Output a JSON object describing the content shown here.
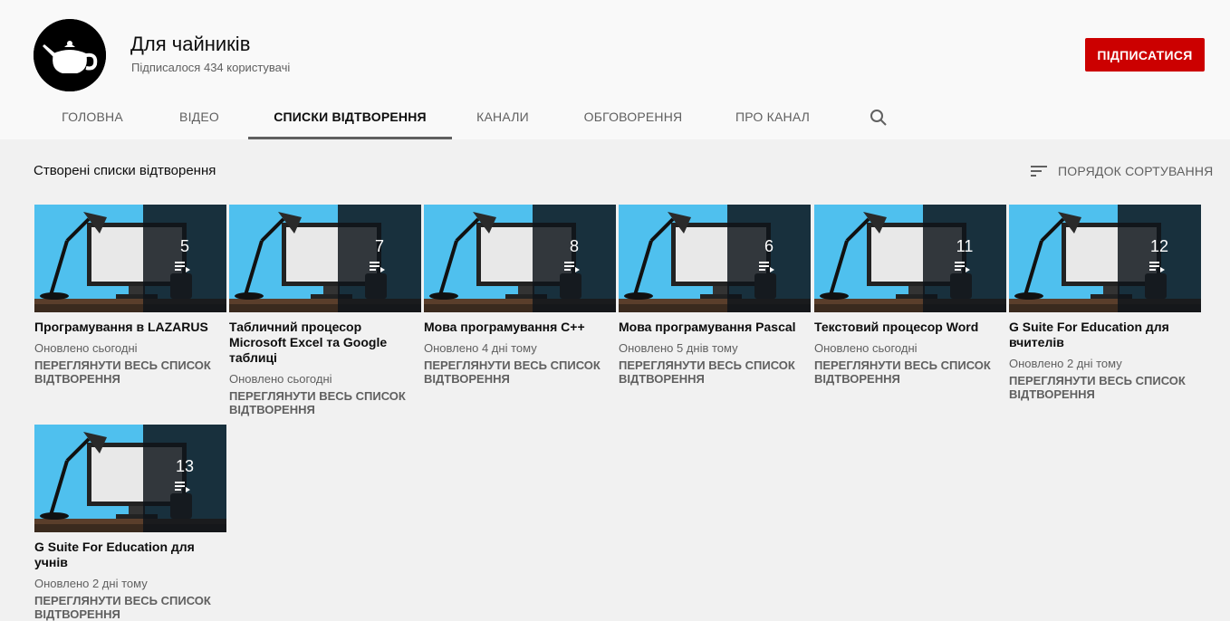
{
  "channel": {
    "name": "Для чайників",
    "subscribers": "Підписалося 434 користувачі",
    "subscribe_label": "ПІДПИСАТИСЯ"
  },
  "tabs": [
    {
      "label": "ГОЛОВНА",
      "active": false
    },
    {
      "label": "ВІДЕО",
      "active": false
    },
    {
      "label": "СПИСКИ ВІДТВОРЕННЯ",
      "active": true
    },
    {
      "label": "КАНАЛИ",
      "active": false
    },
    {
      "label": "ОБГОВОРЕННЯ",
      "active": false
    },
    {
      "label": "ПРО КАНАЛ",
      "active": false
    }
  ],
  "section": {
    "title": "Створені списки відтворення",
    "sort_label": "ПОРЯДОК СОРТУВАННЯ"
  },
  "view_all_label": "ПЕРЕГЛЯНУТИ ВЕСЬ СПИСОК ВІДТВОРЕННЯ",
  "playlists": [
    {
      "title": "Програмування в LAZARUS",
      "updated": "Оновлено сьогодні",
      "count": "5"
    },
    {
      "title": "Табличний процесор Microsoft Excel та Google таблиці",
      "updated": "Оновлено сьогодні",
      "count": "7"
    },
    {
      "title": "Мова програмування C++",
      "updated": "Оновлено 4 дні тому",
      "count": "8"
    },
    {
      "title": "Мова програмування Pascal",
      "updated": "Оновлено 5 днів тому",
      "count": "6"
    },
    {
      "title": "Текстовий процесор Word",
      "updated": "Оновлено сьогодні",
      "count": "11"
    },
    {
      "title": "G Suite For Education для вчителів",
      "updated": "Оновлено 2 дні тому",
      "count": "12"
    },
    {
      "title": "G Suite For Education для учнів",
      "updated": "Оновлено 2 дні тому",
      "count": "13"
    }
  ],
  "colors": {
    "subscribe": "#cc0000",
    "thumb_bg": "#4fc0ee",
    "text_secondary": "#606060"
  },
  "icons": {
    "avatar": "teapot-icon",
    "search": "search-icon",
    "sort": "sort-icon",
    "playlist": "playlist-icon"
  }
}
